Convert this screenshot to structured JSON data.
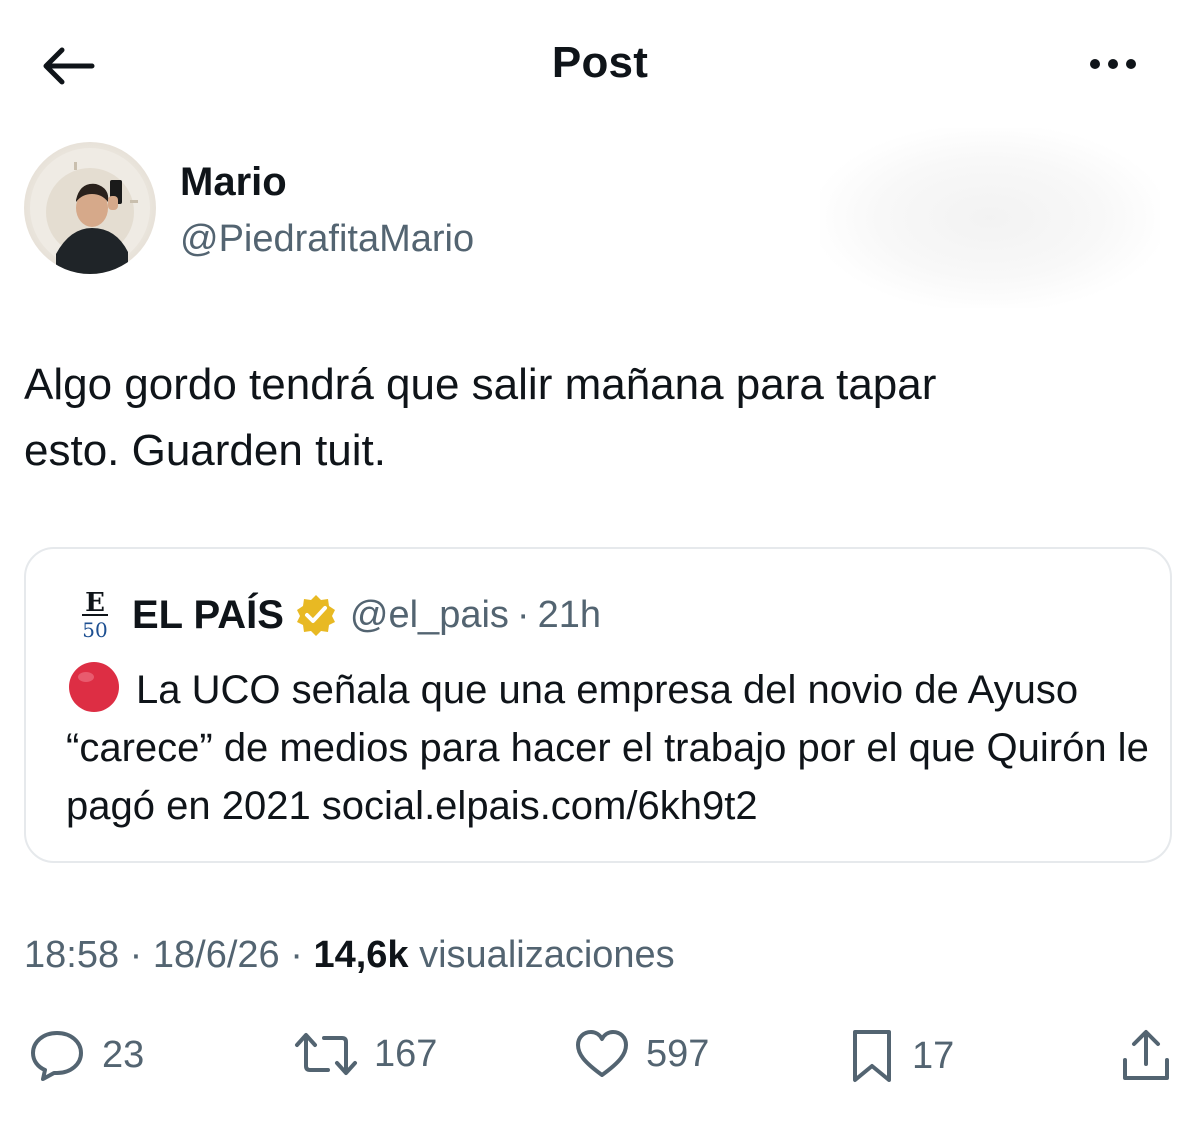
{
  "header": {
    "title": "Post",
    "back_icon": "back-arrow-icon",
    "more_icon": "more-dots-icon"
  },
  "author": {
    "name": "Mario",
    "handle": "@PiedrafitaMario"
  },
  "tweet": {
    "text": "Algo gordo tendrá que salir mañana para tapar\nesto. Guarden tuit."
  },
  "quote": {
    "logo_top": "E",
    "logo_bottom": "50",
    "name": "EL PAÍS",
    "handle": "@el_pais",
    "separator": "·",
    "time": "21h",
    "text": "La UCO señala que una empresa del novio de Ayuso “carece” de medios para hacer el trabajo por el que Quirón le pagó en 2021 social.elpais.com/6kh9t2",
    "verified_color": "#E8B923"
  },
  "meta": {
    "time": "18:58",
    "sep1": " · ",
    "date": "18/6/26",
    "sep2": " · ",
    "views_count": "14,6k",
    "views_label": "visualizaciones"
  },
  "actions": {
    "replies": "23",
    "reposts": "167",
    "likes": "597",
    "bookmarks": "17"
  },
  "colors": {
    "text": "#0f1419",
    "secondary": "#536471",
    "border": "#e6e9ec",
    "red_dot": "#dd2e44"
  }
}
